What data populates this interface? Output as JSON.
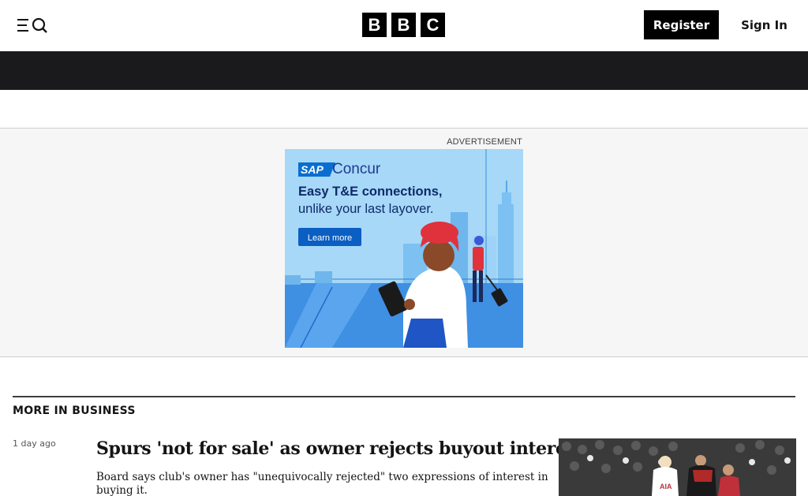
{
  "header": {
    "logo_letters": [
      "B",
      "B",
      "C"
    ],
    "register_label": "Register",
    "signin_label": "Sign In",
    "menu_icon": "menu-search-icon"
  },
  "ad": {
    "label": "ADVERTISEMENT",
    "brand_prefix": "SAP",
    "brand_name": "Concur",
    "headline": "Easy T&E connections,",
    "subline": "unlike your last layover.",
    "cta": "Learn more"
  },
  "more_section": {
    "title": "MORE IN BUSINESS",
    "story": {
      "timestamp": "1 day ago",
      "headline": "Spurs 'not for sale' as owner rejects buyout interest",
      "summary": "Board says club's owner has \"unequivocally rejected\" two expressions of interest in buying it."
    }
  },
  "colors": {
    "navbar": "#1a1a1c",
    "ad_bg": "#a7d8f7",
    "sap_blue": "#0a6ed1",
    "concur_blue": "#1f3a93",
    "cta_blue": "#0b5ec2",
    "turban_red": "#e0323c"
  }
}
